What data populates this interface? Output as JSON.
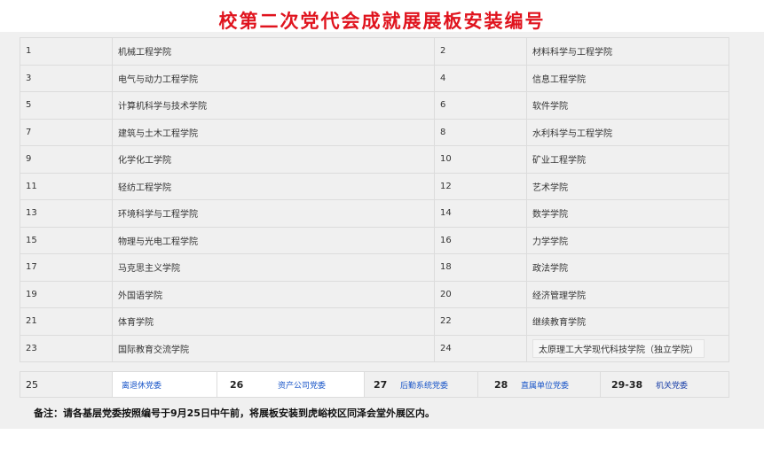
{
  "title": "校第二次党代会成就展展板安装编号",
  "rows": [
    {
      "n1": "1",
      "c1": "机械工程学院",
      "n2": "2",
      "c2": "材料科学与工程学院"
    },
    {
      "n1": "3",
      "c1": "电气与动力工程学院",
      "n2": "4",
      "c2": "信息工程学院"
    },
    {
      "n1": "5",
      "c1": "计算机科学与技术学院",
      "n2": "6",
      "c2": "软件学院"
    },
    {
      "n1": "7",
      "c1": "建筑与土木工程学院",
      "n2": "8",
      "c2": "水利科学与工程学院"
    },
    {
      "n1": "9",
      "c1": "化学化工学院",
      "n2": "10",
      "c2": "矿业工程学院"
    },
    {
      "n1": "11",
      "c1": "轻纺工程学院",
      "n2": "12",
      "c2": "艺术学院"
    },
    {
      "n1": "13",
      "c1": "环境科学与工程学院",
      "n2": "14",
      "c2": "数学学院"
    },
    {
      "n1": "15",
      "c1": "物理与光电工程学院",
      "n2": "16",
      "c2": "力学学院"
    },
    {
      "n1": "17",
      "c1": "马克思主义学院",
      "n2": "18",
      "c2": "政法学院"
    },
    {
      "n1": "19",
      "c1": "外国语学院",
      "n2": "20",
      "c2": "经济管理学院"
    },
    {
      "n1": "21",
      "c1": "体育学院",
      "n2": "22",
      "c2": "继续教育学院"
    },
    {
      "n1": "23",
      "c1": "国际教育交流学院",
      "n2": "24",
      "c2": "太原理工大学现代科技学院（独立学院）"
    }
  ],
  "bottom": [
    {
      "num": "25",
      "label": "离退休党委"
    },
    {
      "num": "26",
      "label": "资产公司党委"
    },
    {
      "num": "27",
      "label": "后勤系统党委"
    },
    {
      "num": "28",
      "label": "直属单位党委"
    },
    {
      "num": "29-38",
      "label": "机关党委"
    }
  ],
  "note": "备注：请各基层党委按照编号于9月25日中午前，将展板安装到虎峪校区同泽会堂外展区内。"
}
